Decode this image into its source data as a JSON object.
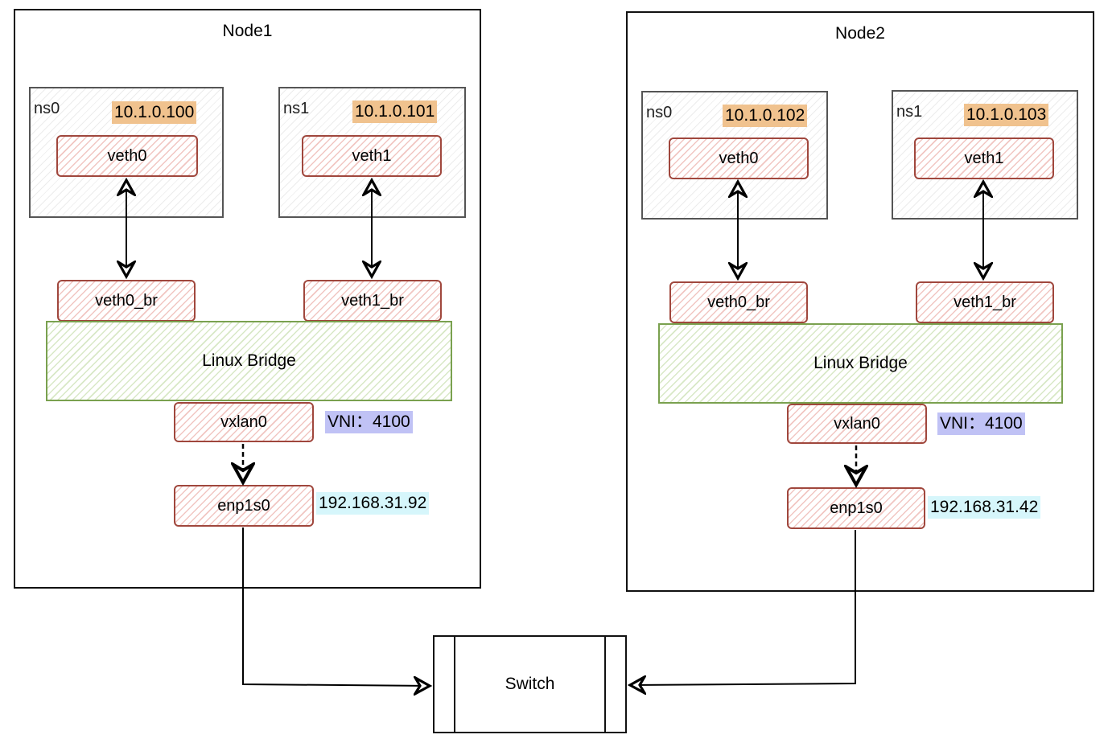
{
  "nodes": [
    {
      "title": "Node1",
      "namespaces": [
        {
          "label": "ns0",
          "ip": "10.1.0.100",
          "iface": "veth0"
        },
        {
          "label": "ns1",
          "ip": "10.1.0.101",
          "iface": "veth1"
        }
      ],
      "bridge_ports": [
        "veth0_br",
        "veth1_br"
      ],
      "bridge_label": "Linux Bridge",
      "vxlan": {
        "label": "vxlan0",
        "vni": "VNI：4100"
      },
      "nic": {
        "label": "enp1s0",
        "ip": "192.168.31.92"
      }
    },
    {
      "title": "Node2",
      "namespaces": [
        {
          "label": "ns0",
          "ip": "10.1.0.102",
          "iface": "veth0"
        },
        {
          "label": "ns1",
          "ip": "10.1.0.103",
          "iface": "veth1"
        }
      ],
      "bridge_ports": [
        "veth0_br",
        "veth1_br"
      ],
      "bridge_label": "Linux Bridge",
      "vxlan": {
        "label": "vxlan0",
        "vni": "VNI：4100"
      },
      "nic": {
        "label": "enp1s0",
        "ip": "192.168.31.42"
      }
    }
  ],
  "switch": {
    "label": "Switch"
  },
  "colors": {
    "ns_ip_highlight": "#f0c28e",
    "vni_highlight": "#c0c2f5",
    "nic_ip_highlight": "#d6f6fb",
    "interface_stroke": "#a0473d",
    "bridge_stroke": "#7aa14f"
  }
}
